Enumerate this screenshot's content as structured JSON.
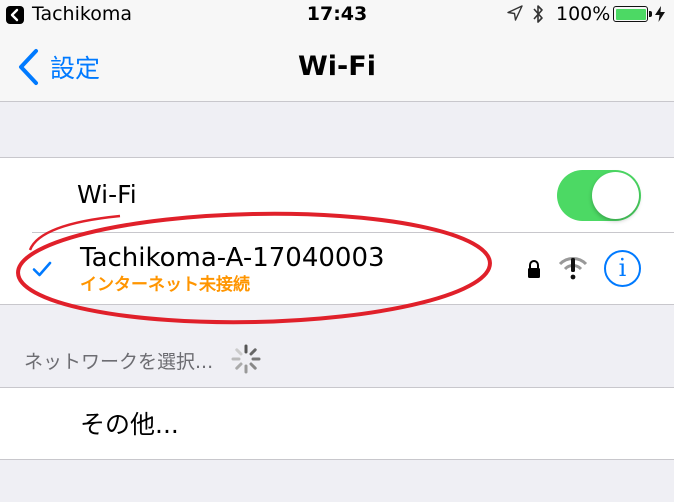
{
  "status_bar": {
    "back_app": "Tachikoma",
    "time": "17:43",
    "battery_percent": "100%",
    "icons": [
      "back-arrow-icon",
      "location-icon",
      "bluetooth-icon",
      "battery-icon",
      "charging-bolt-icon"
    ],
    "battery_color": "#4cd964"
  },
  "nav": {
    "back_label": "設定",
    "title": "Wi-Fi"
  },
  "wifi": {
    "label": "Wi-Fi",
    "enabled": true,
    "toggle_color": "#4cd964"
  },
  "network": {
    "name": "Tachikoma-A-17040003",
    "status": "インターネット未接続",
    "status_color": "#ff9500",
    "connected": true,
    "secured": true,
    "info": "i"
  },
  "networks_section": {
    "header": "ネットワークを選択..."
  },
  "other": {
    "label": "その他..."
  },
  "annotation": {
    "shape": "ellipse",
    "color": "#e0202a"
  }
}
